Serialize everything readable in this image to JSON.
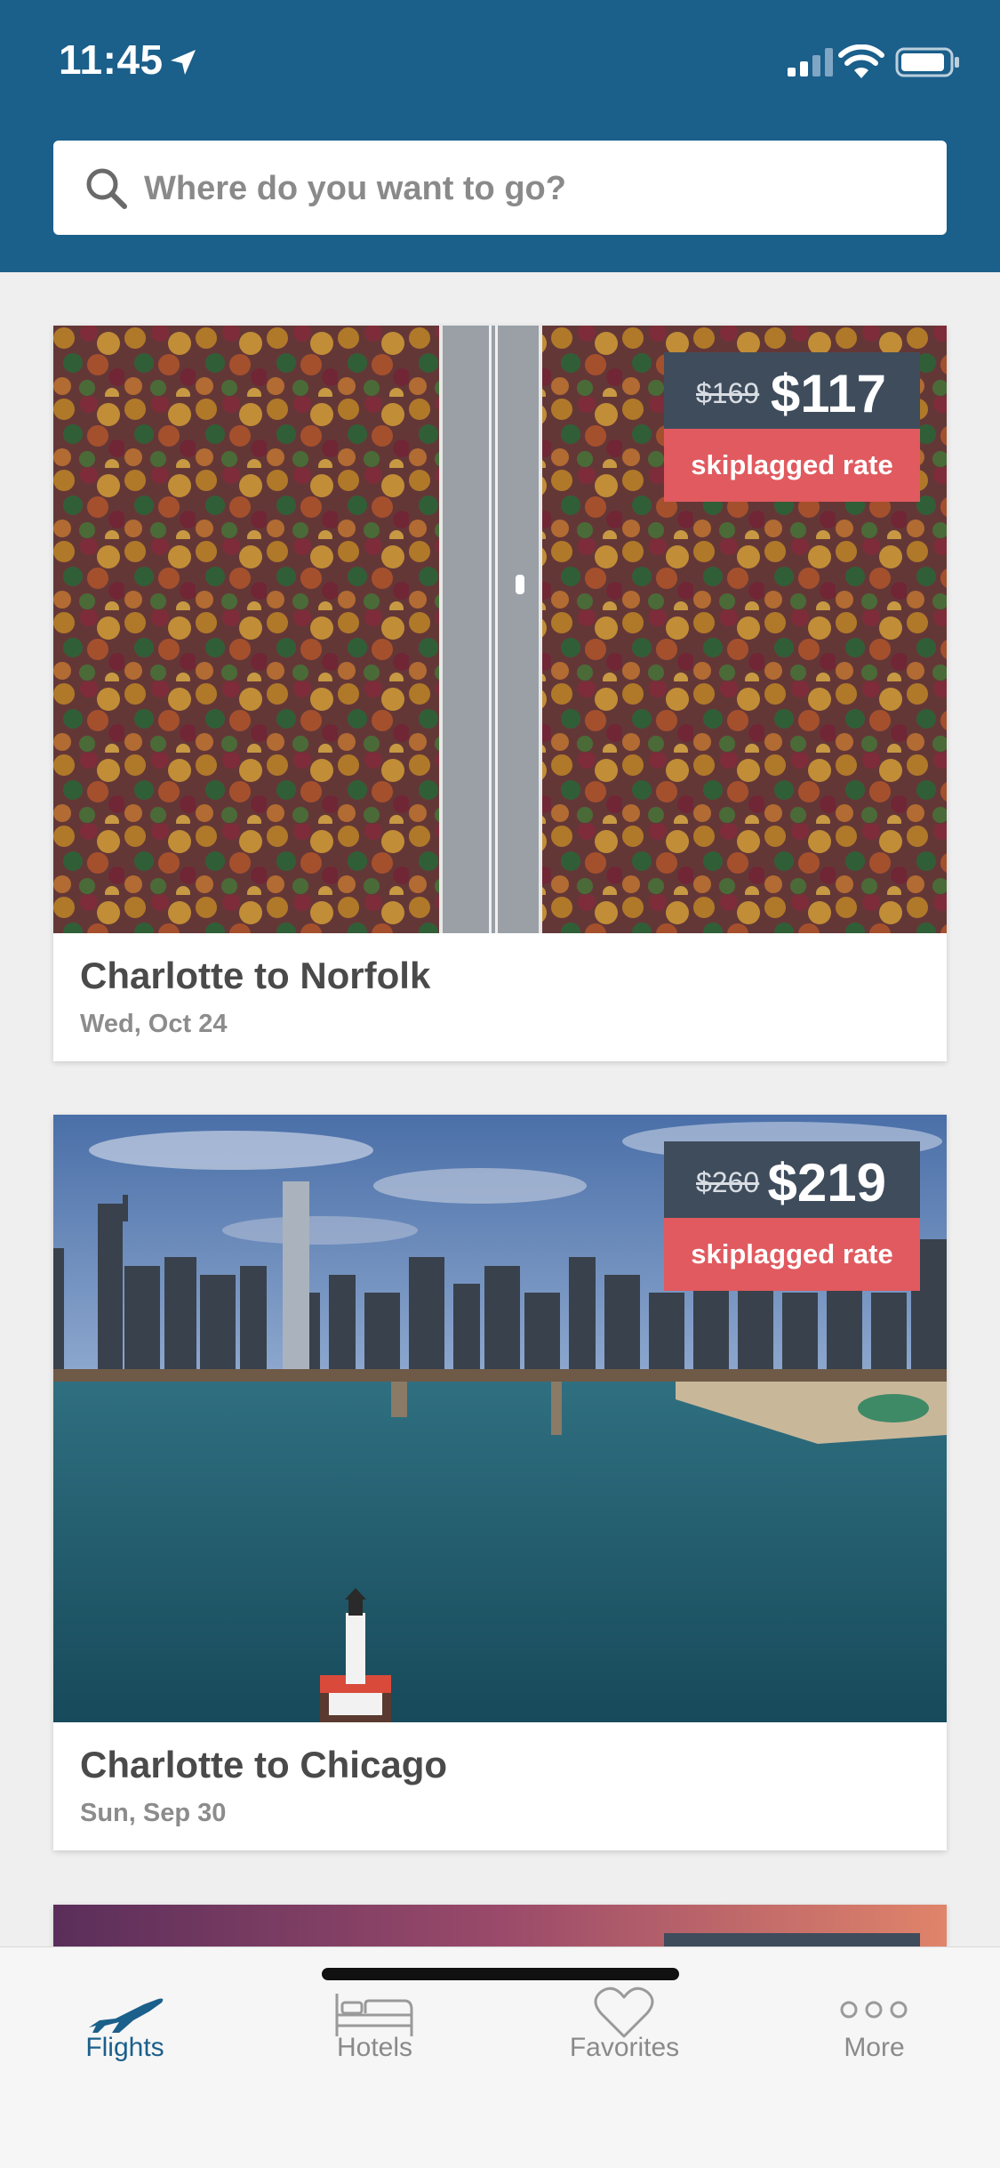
{
  "status_bar": {
    "time": "11:45"
  },
  "search": {
    "placeholder": "Where do you want to go?"
  },
  "deals": [
    {
      "title": "Charlotte to Norfolk",
      "date": "Wed, Oct 24",
      "old_price": "$169",
      "new_price": "$117",
      "badge": "skiplagged rate"
    },
    {
      "title": "Charlotte to Chicago",
      "date": "Sun, Sep 30",
      "old_price": "$260",
      "new_price": "$219",
      "badge": "skiplagged rate"
    }
  ],
  "tabs": [
    {
      "label": "Flights",
      "icon": "plane-icon",
      "active": true
    },
    {
      "label": "Hotels",
      "icon": "bed-icon",
      "active": false
    },
    {
      "label": "Favorites",
      "icon": "heart-icon",
      "active": false
    },
    {
      "label": "More",
      "icon": "more-icon",
      "active": false
    }
  ],
  "colors": {
    "header": "#1b5f8b",
    "price_box": "#3f4c5c",
    "rate_badge": "#e05a5f",
    "active_tab": "#1b5f8b"
  }
}
